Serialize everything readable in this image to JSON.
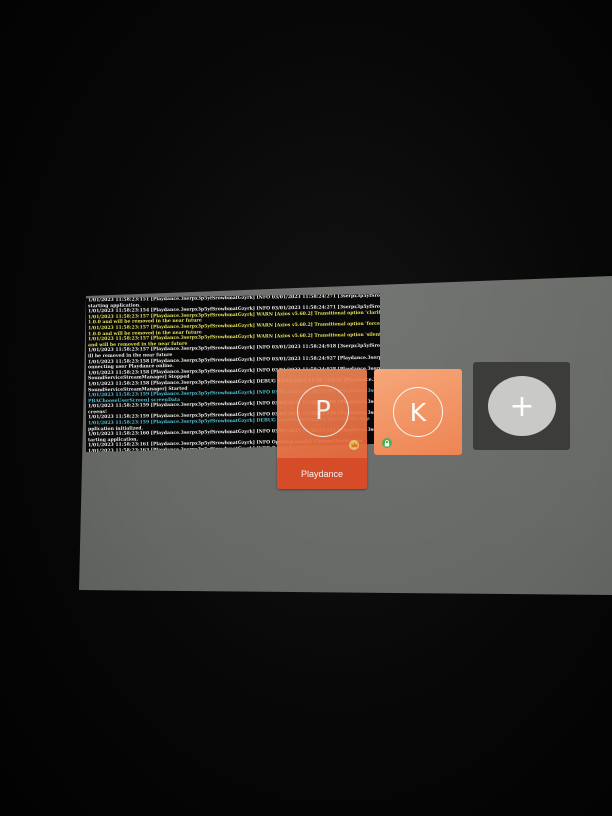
{
  "console": {
    "lines": [
      {
        "level": "info",
        "text": "1/01/2023 11:58:23:151 [Playdance.3serpx3p5yfSrowbmatGzyrk] INFO 03/01/2023 11:58:24:271 [3serpx3p5yfSrowbmatGzyrk] INFO [AppController]"
      },
      {
        "level": "info",
        "text": "starting application."
      },
      {
        "level": "info",
        "text": "1/01/2023 11:58:23:154 [Playdance.3serpx3p5yfSrowbmatGzyrk] INFO 03/01/2023 11:58:24:271 [3serpx3p5yfSrowbmatGzyrk] INFO Closing all screens!"
      },
      {
        "level": "warn",
        "text": "1/01/2023 11:58:23:157 [Playdance.3serpx3p5yfSrowbmatGzyrk] WARN [Axios v5.60.2] Transitional option 'clarifyTimeoutError' has been deprecated since"
      },
      {
        "level": "warn",
        "text": "1.0.0 and will be removed in the near future"
      },
      {
        "level": "warn",
        "text": "1/01/2023 11:58:23:157 [Playdance.3serpx3p5yfSrowbmatGzyrk] WARN [Axios v5.60.2] Transitional option 'forcedJSONParsing' has been deprecated since"
      },
      {
        "level": "warn",
        "text": "1.0.0 and will be removed in the near future"
      },
      {
        "level": "warn",
        "text": "1/01/2023 11:58:23:157 [Playdance.3serpx3p5yfSrowbmatGzyrk] WARN [Axios v5.60.2] Transitional option 'silentJSONParsing' has been deprecated since v1.0.0"
      },
      {
        "level": "warn",
        "text": "and will be removed in the near future"
      },
      {
        "level": "info",
        "text": "1/01/2023 11:58:23:157 [Playdance.3serpx3p5yfSrowbmatGzyrk] INFO 03/01/2023 11:58:24:918 [3serpx3p5yfSrowbmatGzyrk] INFO [UserManager]"
      },
      {
        "level": "info",
        "text": "ill be removed in the near future"
      },
      {
        "level": "info",
        "text": "1/01/2023 11:58:23:158 [Playdance.3serpx3p5yfSrowbmatGzyrk] INFO 03/01/2023 11:58:24:927 [Playdance.3serpx3p5yfSrowbmatGzyrk] INFO"
      },
      {
        "level": "info",
        "text": "onnecting user Playdance online."
      },
      {
        "level": "info",
        "text": "1/01/2023 11:58:23:158 [Playdance.3serpx3p5yfSrowbmatGzyrk] INFO 03/01/2023 11:58:24:928 [Playdance.3serpx3p5yfSrowbmatGzyrk] DEBUG"
      },
      {
        "level": "info",
        "text": "SoundServiceStreamManager] Stopped"
      },
      {
        "level": "info",
        "text": "1/01/2023 11:58:23:158 [Playdance.3serpx3p5yfSrowbmatGzyrk] DEBUG 03/01/2023 11:58:24:933 [Playdance.3serpx3p5yfSrowbmatGzyrk] DEBUG"
      },
      {
        "level": "info",
        "text": "SoundServiceStreamManager] Started"
      },
      {
        "level": "debug",
        "text": "1/01/2023 11:58:23:159 [Playdance.3serpx3p5yfSrowbmatGzyrk] INFO 03/01/2023 11:58:25:107 [Playdance.3serpx3p5yfSrowbmatGzyrk] INFO Closing all"
      },
      {
        "level": "debug",
        "text": "PBAChooseUserScreen] screenData"
      },
      {
        "level": "info",
        "text": "1/01/2023 11:58:23:159 [Playdance.3serpx3p5yfSrowbmatGzyrk] INFO 03/01/2023 11:58:25:108 [Playdance.3serpx3p5yfSrowbmatGzyrk] INFO [AppController]"
      },
      {
        "level": "info",
        "text": "creens!"
      },
      {
        "level": "info",
        "text": "1/01/2023 11:58:23:159 [Playdance.3serpx3p5yfSrowbmatGzyrk] INFO 03/01/2023 11:58:25:120 [Playdance.3serpx3p5yfSrowbmatGzyrk] INFO [AppController]"
      },
      {
        "level": "debug",
        "text": "1/01/2023 11:58:23:159 [Playdance.3serpx3p5yfSrowbmatGzyrk] DEBUG [AppBootstrapper] Starting the app"
      },
      {
        "level": "info",
        "text": "pplication initialized."
      },
      {
        "level": "info",
        "text": "1/01/2023 11:58:23:160 [Playdance.3serpx3p5yfSrowbmatGzyrk] INFO 03/01/2023 11:58:23:121 [Playdance.3serpx3p5yfSrowbmatGzyrk] INFO [AppController]"
      },
      {
        "level": "info",
        "text": "tarting application."
      },
      {
        "level": "info",
        "text": "1/01/2023 11:58:23:161 [Playdance.3serpx3p5yfSrowbmatGzyrk] INFO Opening modal: ChooseUserScreen"
      },
      {
        "level": "info",
        "text": "1/01/2023 11:58:23:163 [Playdance.3serpx3p5yfSrowbmatGzyrk] INFO Opened modal: ChooseUserScreen"
      }
    ]
  },
  "profiles": [
    {
      "id": "playdance",
      "initial": "P",
      "label": "Playdance",
      "badge_icon": "crown-icon",
      "color": "#e5562f"
    },
    {
      "id": "k",
      "initial": "K",
      "label": "",
      "badge_icon": "lock-icon",
      "color": "#f08a5c"
    }
  ],
  "add_profile": {
    "glyph": "+",
    "icon": "plus-icon"
  },
  "colors": {
    "accent": "#e5562f",
    "tile_light": "#f6a77a",
    "add_tile_bg": "#3c3c3b",
    "add_circle": "#c9cac8",
    "log_warn": "#e6e25a",
    "log_debug": "#4fc3d8",
    "lock_badge": "#4caf50",
    "crown_badge": "#f3c86a"
  }
}
